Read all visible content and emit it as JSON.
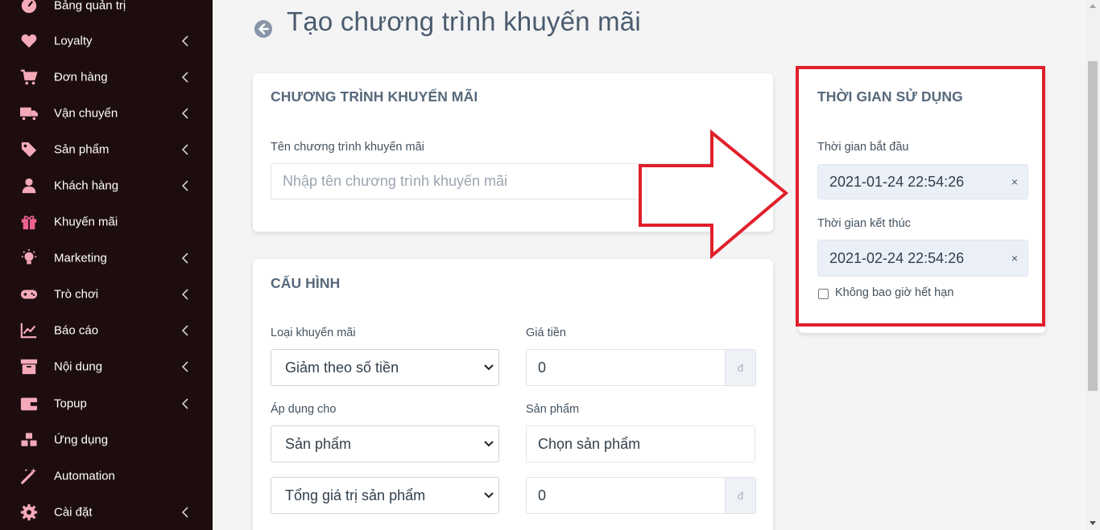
{
  "sidebar": {
    "items": [
      {
        "label": "Bảng quản trị",
        "icon": "dashboard-icon",
        "has_submenu": false
      },
      {
        "label": "Loyalty",
        "icon": "heart-icon",
        "has_submenu": true
      },
      {
        "label": "Đơn hàng",
        "icon": "cart-icon",
        "has_submenu": true
      },
      {
        "label": "Vận chuyển",
        "icon": "truck-icon",
        "has_submenu": true
      },
      {
        "label": "Sản phẩm",
        "icon": "tag-icon",
        "has_submenu": true
      },
      {
        "label": "Khách hàng",
        "icon": "user-icon",
        "has_submenu": true
      },
      {
        "label": "Khuyến mãi",
        "icon": "gift-icon",
        "has_submenu": false
      },
      {
        "label": "Marketing",
        "icon": "lightbulb-icon",
        "has_submenu": true
      },
      {
        "label": "Trò chơi",
        "icon": "gamepad-icon",
        "has_submenu": true
      },
      {
        "label": "Báo cáo",
        "icon": "chart-line-icon",
        "has_submenu": true
      },
      {
        "label": "Nội dung",
        "icon": "archive-icon",
        "has_submenu": true
      },
      {
        "label": "Topup",
        "icon": "wallet-icon",
        "has_submenu": true
      },
      {
        "label": "Ứng dụng",
        "icon": "cubes-icon",
        "has_submenu": false
      },
      {
        "label": "Automation",
        "icon": "magic-wand-icon",
        "has_submenu": false
      },
      {
        "label": "Cài đặt",
        "icon": "gear-icon",
        "has_submenu": true
      }
    ]
  },
  "header": {
    "title": "Tạo chương trình khuyến mãi",
    "back_icon": "arrow-circle-left-icon"
  },
  "promo_card": {
    "title": "CHƯƠNG TRÌNH KHUYẾN MÃI",
    "name_label": "Tên chương trình khuyến mãi",
    "name_placeholder": "Nhập tên chương trình khuyến mãi"
  },
  "config_card": {
    "title": "CẤU HÌNH",
    "promo_type_label": "Loại khuyến mãi",
    "promo_type_value": "Giảm theo số tiền",
    "price_label": "Giá tiền",
    "price_value": "0",
    "currency": "đ",
    "apply_label": "Áp dụng cho",
    "apply_value": "Sản phẩm",
    "product_label": "Sản phẩm",
    "product_value": "Chọn sản phẩm",
    "condition_value": "Tổng giá trị sản phẩm",
    "condition_amount": "0"
  },
  "time_card": {
    "title": "THỜI GIAN SỬ DỤNG",
    "start_label": "Thời gian bắt đầu",
    "start_value": "2021-01-24 22:54:26",
    "end_label": "Thời gian kết thúc",
    "end_value": "2021-02-24 22:54:26",
    "clear_symbol": "×",
    "never_expire_label": "Không bao giờ hết hạn",
    "never_expire_checked": false
  },
  "colors": {
    "sidebar_bg": "#1d0d0f",
    "icon_pink": "#f4a9b9",
    "highlight_red": "#e0202b"
  }
}
